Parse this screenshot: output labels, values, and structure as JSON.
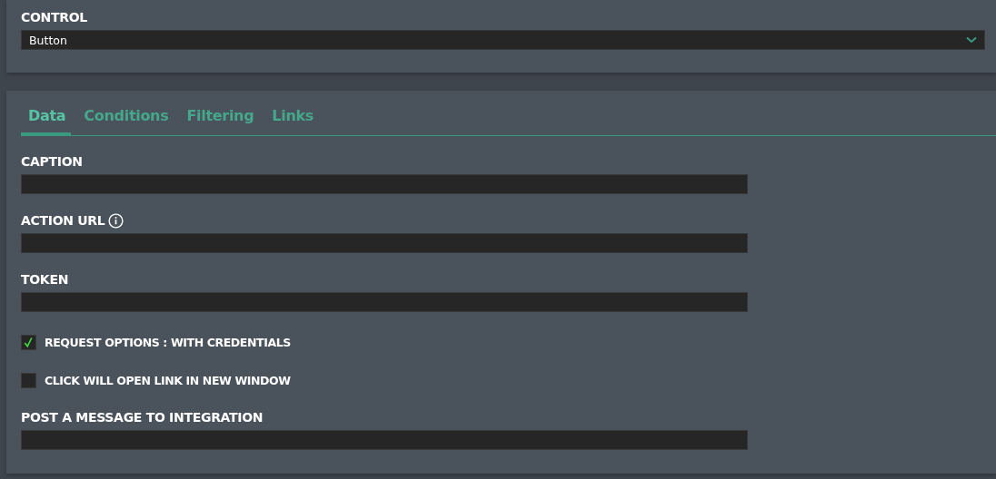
{
  "control": {
    "label": "CONTROL",
    "value": "Button"
  },
  "tabs": [
    {
      "label": "Data",
      "selected": true
    },
    {
      "label": "Conditions",
      "selected": false
    },
    {
      "label": "Filtering",
      "selected": false
    },
    {
      "label": "Links",
      "selected": false
    }
  ],
  "fields": [
    {
      "kind": "text",
      "label": "CAPTION",
      "info": false
    },
    {
      "kind": "text",
      "label": "ACTION URL",
      "info": true
    },
    {
      "kind": "text",
      "label": "TOKEN",
      "info": false
    },
    {
      "kind": "checkbox",
      "label": "REQUEST OPTIONS : WITH CREDENTIALS",
      "checked": true
    },
    {
      "kind": "checkbox",
      "label": "CLICK WILL OPEN LINK IN NEW WINDOW",
      "checked": false
    },
    {
      "kind": "text",
      "label": "POST A MESSAGE TO INTEGRATION",
      "info": false
    }
  ]
}
